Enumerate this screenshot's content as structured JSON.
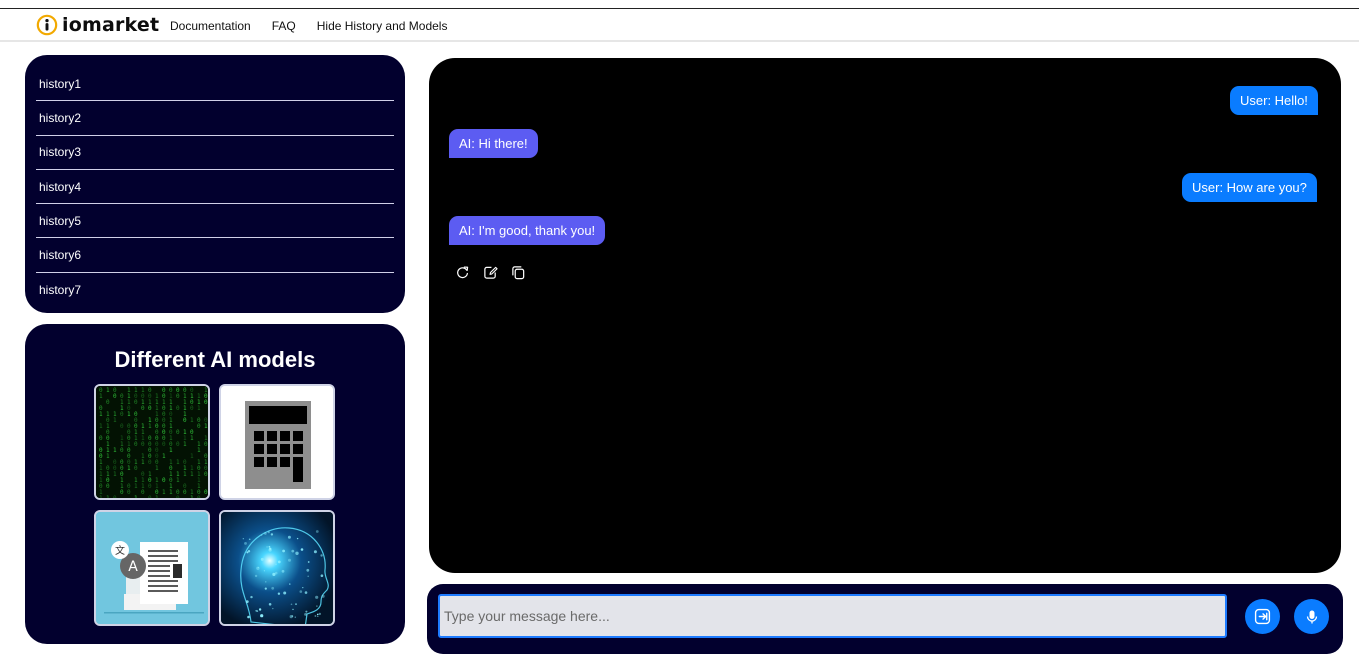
{
  "brand": {
    "name": "iomarket"
  },
  "nav": {
    "links": [
      "Documentation",
      "FAQ",
      "Hide History and Models"
    ]
  },
  "history": {
    "items": [
      "history1",
      "history2",
      "history3",
      "history4",
      "history5",
      "history6",
      "history7"
    ]
  },
  "models": {
    "title": "Different AI models",
    "tiles": [
      {
        "name": "matrix-code-model"
      },
      {
        "name": "calculator-model"
      },
      {
        "name": "translation-model"
      },
      {
        "name": "ai-brain-model"
      }
    ]
  },
  "chat": {
    "messages": [
      {
        "role": "user",
        "text": "User: Hello!"
      },
      {
        "role": "ai",
        "text": "AI: Hi there!"
      },
      {
        "role": "user",
        "text": "User: How are you?"
      },
      {
        "role": "ai",
        "text": "AI: I'm good, thank you!"
      }
    ],
    "actions": [
      "regenerate-icon",
      "edit-icon",
      "copy-icon"
    ]
  },
  "composer": {
    "placeholder": "Type your message here...",
    "send_icon": "send-icon",
    "mic_icon": "microphone-icon"
  },
  "colors": {
    "panel": "#02002e",
    "chat_bg": "#000000",
    "user_bubble": "#0a7cff",
    "ai_bubble": "#5c5cf2",
    "logo_accent": "#f2a900"
  }
}
